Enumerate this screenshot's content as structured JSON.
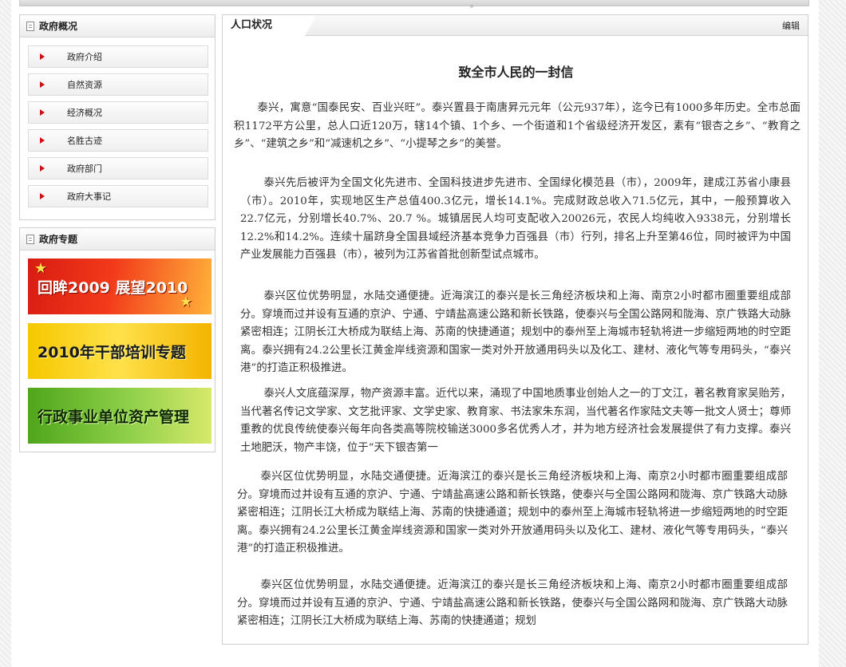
{
  "top_bar": {
    "marker": "。"
  },
  "sidebar": {
    "overview": {
      "title": "政府概况",
      "items": [
        {
          "label": "政府介绍"
        },
        {
          "label": "自然资源"
        },
        {
          "label": "经济概况"
        },
        {
          "label": "名胜古迹"
        },
        {
          "label": "政府部门"
        },
        {
          "label": "政府大事记"
        }
      ]
    },
    "topics": {
      "title": "政府专题",
      "banners": [
        {
          "label": "回眸2009 展望2010"
        },
        {
          "label": "2010年干部培训专题"
        },
        {
          "label": "行政事业单位资产管理"
        }
      ]
    }
  },
  "main": {
    "tab_label": "人口状况",
    "edit_label": "编辑",
    "article_title": "致全市人民的一封信",
    "paragraphs": [
      "泰兴，寓意“国泰民安、百业兴旺”。泰兴置县于南唐昇元元年（公元937年），迄今已有1000多年历史。全市总面积1172平方公里，总人口近120万，辖14个镇、1个乡、一个街道和1个省级经济开发区，素有“银杏之乡”、“教育之乡”、“建筑之乡”和“减速机之乡”、“小提琴之乡”的美誉。",
      "泰兴先后被评为全国文化先进市、全国科技进步先进市、全国绿化模范县（市），2009年，建成江苏省小康县（市）。2010年，实现地区生产总值400.3亿元，增长14.1%。完成财政总收入71.5亿元，其中，一般预算收入22.7亿元，分别增长40.7%、20.7 %。城镇居民人均可支配收入20026元，农民人均纯收入9338元，分别增长12.2%和14.2%。连续十届跻身全国县域经济基本竞争力百强县（市）行列，排名上升至第46位，同时被评为中国产业发展能力百强县（市），被列为江苏省首批创新型试点城市。",
      "泰兴区位优势明显，水陆交通便捷。近海滨江的泰兴是长三角经济板块和上海、南京2小时都市圈重要组成部分。穿境而过并设有互通的京沪、宁通、宁靖盐高速公路和新长铁路，使泰兴与全国公路网和陇海、京广铁路大动脉紧密相连；江阴长江大桥成为联结上海、苏南的快捷通道；规划中的泰州至上海城市轻轨将进一步缩短两地的时空距离。泰兴拥有24.2公里长江黄金岸线资源和国家一类对外开放通用码头以及化工、建材、液化气等专用码头，“泰兴港”的打造正积极推进。",
      "泰兴人文底蕴深厚，物产资源丰富。近代以来，涌现了中国地质事业创始人之一的丁文江，著名教育家吴贻芳，当代著名传记文学家、文艺批评家、文学史家、教育家、书法家朱东润，当代著名作家陆文夫等一批文人贤士；尊师重教的优良传统使泰兴每年向各类高等院校输送3000多名优秀人才，并为地方经济社会发展提供了有力支撑。泰兴土地肥沃，物产丰饶，位于“天下银杏第一",
      "泰兴区位优势明显，水陆交通便捷。近海滨江的泰兴是长三角经济板块和上海、南京2小时都市圈重要组成部分。穿境而过并设有互通的京沪、宁通、宁靖盐高速公路和新长铁路，使泰兴与全国公路网和陇海、京广铁路大动脉紧密相连；江阴长江大桥成为联结上海、苏南的快捷通道；规划中的泰州至上海城市轻轨将进一步缩短两地的时空距离。泰兴拥有24.2公里长江黄金岸线资源和国家一类对外开放通用码头以及化工、建材、液化气等专用码头，“泰兴港”的打造正积极推进。",
      "泰兴区位优势明显，水陆交通便捷。近海滨江的泰兴是长三角经济板块和上海、南京2小时都市圈重要组成部分。穿境而过并设有互通的京沪、宁通、宁靖盐高速公路和新长铁路，使泰兴与全国公路网和陇海、京广铁路大动脉紧密相连；江阴长江大桥成为联结上海、苏南的快捷通道；规划"
    ]
  }
}
